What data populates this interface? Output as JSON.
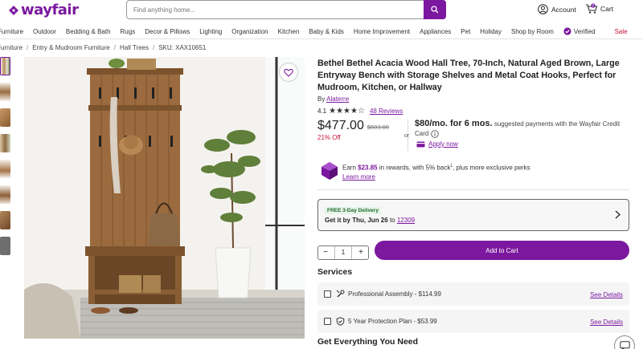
{
  "brand": {
    "name": "wayfair",
    "color": "#7b189f"
  },
  "search": {
    "placeholder": "Find anything home..."
  },
  "header": {
    "account_label": "Account",
    "cart_label": "Cart",
    "cart_count": "0"
  },
  "categories": [
    "Furniture",
    "Outdoor",
    "Bedding & Bath",
    "Rugs",
    "Decor & Pillows",
    "Lighting",
    "Organization",
    "Kitchen",
    "Baby & Kids",
    "Home Improvement",
    "Appliances",
    "Pet",
    "Holiday",
    "Shop by Room",
    "Verified",
    "Sale"
  ],
  "breadcrumb": {
    "items": [
      "Furniture",
      "Entry & Mudroom Furniture",
      "Hall Trees"
    ],
    "sku": "SKU: XAX10651"
  },
  "product": {
    "title": "Bethel Bethel Acacia Wood Hall Tree, 70-Inch, Natural Aged Brown, Large Entryway Bench with Storage Shelves and Metal Coat Hooks, Perfect for Mudroom, Kitchen, or Hallway",
    "by_label": "By",
    "brand": "Alaterre",
    "rating": "4.1",
    "stars": 4,
    "reviews": "48 Reviews",
    "price": "$477.00",
    "was_price": "$603.00",
    "discount": "21% Off"
  },
  "financing": {
    "or": "or",
    "monthly": "$80/mo. for 6 mos.",
    "desc": "suggested payments with the Wayfair Credit Card",
    "apply": "Apply now"
  },
  "rewards": {
    "earn": "Earn",
    "amount": "$23.85",
    "rest": "in rewards, with 5% back",
    "sup": "1",
    "tail": ", plus more exclusive perks",
    "learn": "Learn more"
  },
  "delivery": {
    "badge": "FREE 3-Day Delivery",
    "prefix": "Get it by",
    "date": "Thu, Jun 26",
    "to": "to",
    "zip": "12309"
  },
  "cart": {
    "qty": "1",
    "minus": "−",
    "plus": "+",
    "add_label": "Add to Cart"
  },
  "services": {
    "heading": "Services",
    "items": [
      {
        "label": "Professional Assembly - $114.99",
        "details": "See Details"
      },
      {
        "label": "5 Year Protection Plan - $53.99",
        "details": "See Details"
      }
    ]
  },
  "section2": {
    "heading": "Get Everything You Need"
  }
}
